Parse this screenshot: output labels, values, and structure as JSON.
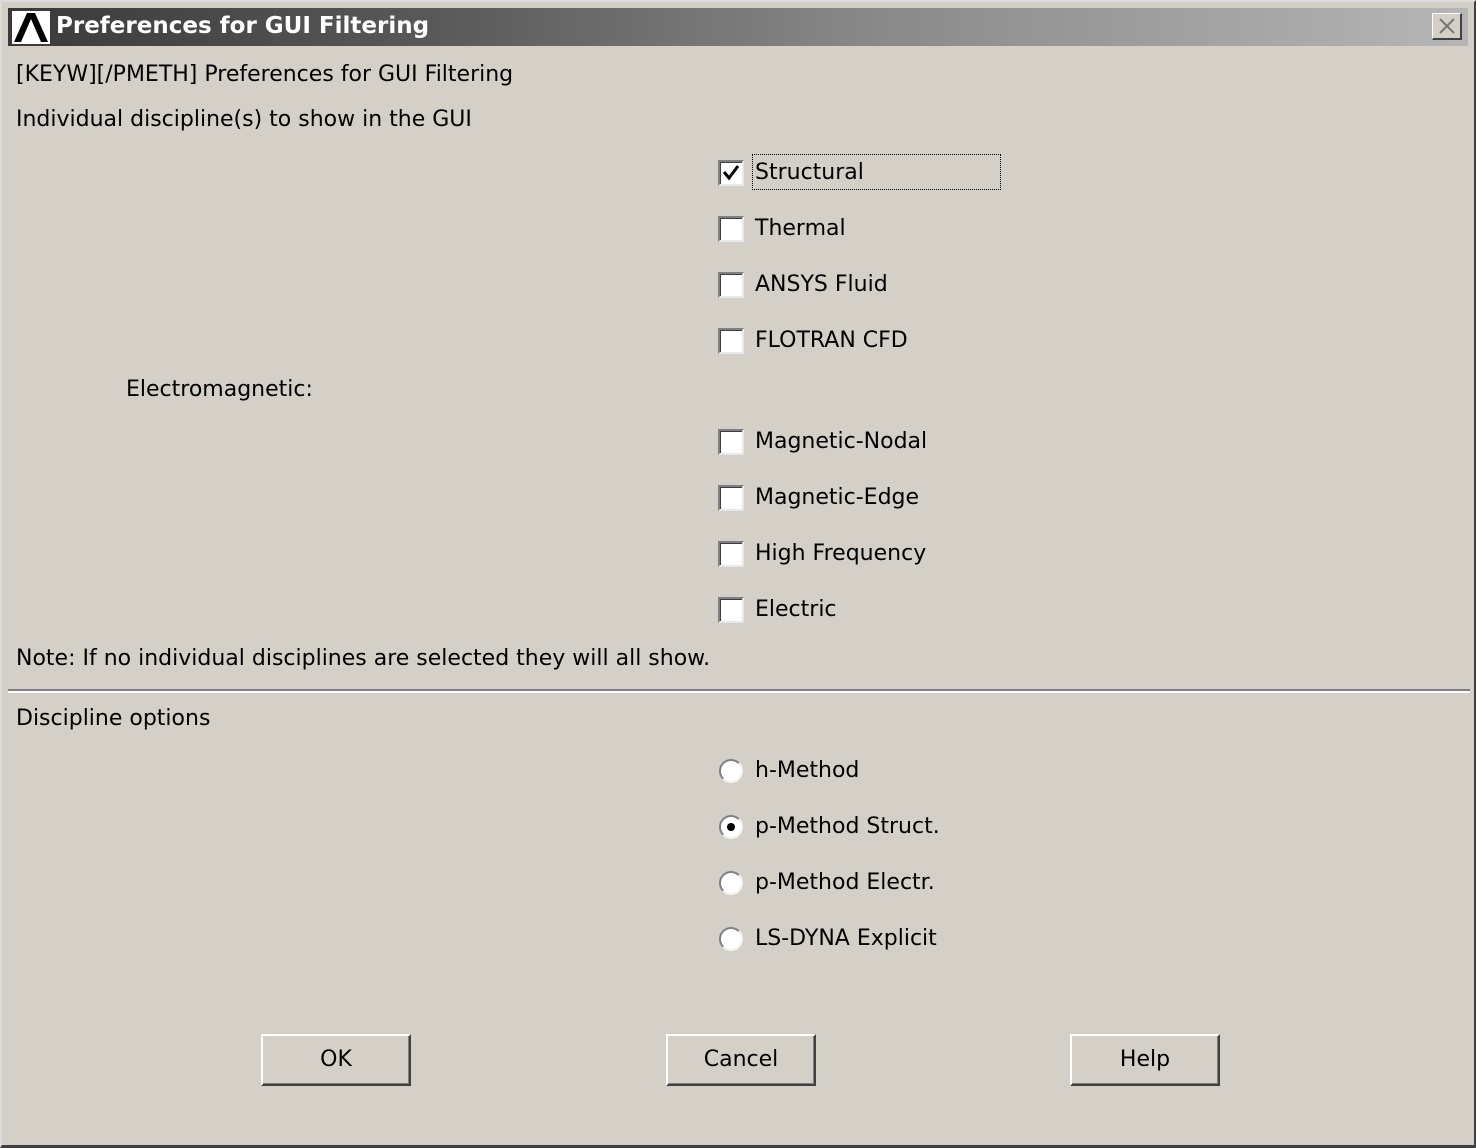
{
  "window": {
    "title": "Preferences for GUI Filtering",
    "close_icon": "close-icon",
    "app_icon": "ansys-logo-icon"
  },
  "header": {
    "command_line": "[KEYW][/PMETH] Preferences for GUI Filtering",
    "section_title": "Individual discipline(s) to show in the GUI"
  },
  "disciplines": {
    "structural": {
      "label": "Structural",
      "checked": true
    },
    "thermal": {
      "label": "Thermal",
      "checked": false
    },
    "ansys_fluid": {
      "label": "ANSYS Fluid",
      "checked": false
    },
    "flotran_cfd": {
      "label": "FLOTRAN CFD",
      "checked": false
    },
    "electromagnetic_heading": "Electromagnetic:",
    "magnetic_nodal": {
      "label": "Magnetic-Nodal",
      "checked": false
    },
    "magnetic_edge": {
      "label": "Magnetic-Edge",
      "checked": false
    },
    "high_frequency": {
      "label": "High Frequency",
      "checked": false
    },
    "electric": {
      "label": "Electric",
      "checked": false
    },
    "note": "Note: If no individual disciplines are selected they will all show."
  },
  "options": {
    "title": "Discipline options",
    "selected": "p-Method Struct.",
    "h_method": "h-Method",
    "p_method_struct": "p-Method Struct.",
    "p_method_electr": "p-Method Electr.",
    "ls_dyna": "LS-DYNA Explicit"
  },
  "buttons": {
    "ok": "OK",
    "cancel": "Cancel",
    "help": "Help"
  }
}
